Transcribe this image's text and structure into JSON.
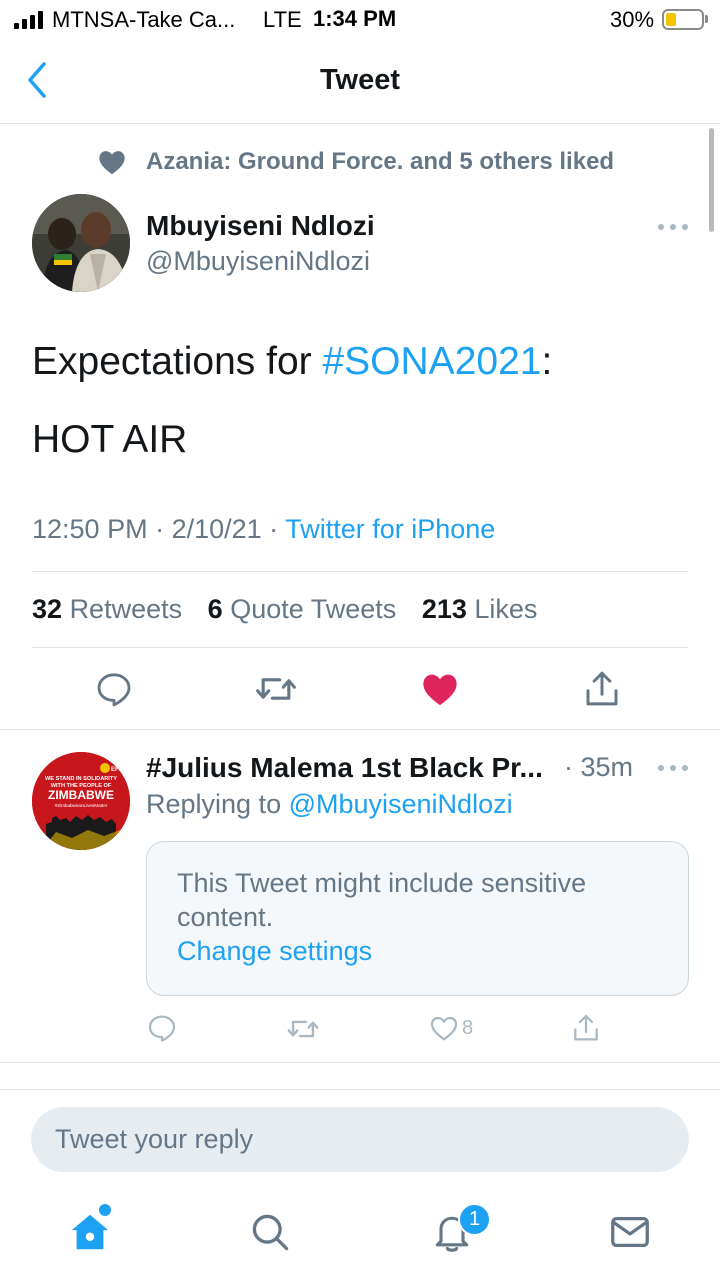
{
  "status_bar": {
    "carrier": "MTNSA-Take Ca...",
    "network": "LTE",
    "time": "1:34 PM",
    "battery_percent": "30%",
    "battery_level": 0.3
  },
  "nav": {
    "title": "Tweet",
    "back_icon": "chevron-left-icon"
  },
  "tweet": {
    "social_context": "Azania: Ground Force. and 5 others liked",
    "author_name": "Mbuyiseni Ndlozi",
    "author_handle": "@MbuyiseniNdlozi",
    "text_prefix": "Expectations for ",
    "hashtag": "#SONA2021",
    "text_suffix": ":",
    "text_line2": "HOT AIR",
    "time": "12:50 PM",
    "date": "2/10/21",
    "meta_sep": " · ",
    "source": "Twitter for iPhone",
    "stats": {
      "retweets_count": "32",
      "retweets_label": "Retweets",
      "quotes_count": "6",
      "quotes_label": "Quote Tweets",
      "likes_count": "213",
      "likes_label": "Likes"
    },
    "liked": true
  },
  "reply": {
    "author_name": "#Julius Malema 1st Black Pr...",
    "time": "· 35m",
    "replying_prefix": "Replying to ",
    "replying_to": "@MbuyiseniNdlozi",
    "sensitive_text": "This Tweet might include sensitive content.",
    "change_settings": "Change settings",
    "like_count": "8",
    "avatar_text": {
      "line1": "WE STAND IN SOLIDARITY",
      "line2": "WITH THE PEOPLE OF",
      "line3": "ZIMBABWE",
      "line4": "#ZimbabweanLivesMatter",
      "logo": "EFF"
    }
  },
  "composer": {
    "placeholder": "Tweet your reply"
  },
  "tab_bar": {
    "notifications_badge": "1"
  },
  "colors": {
    "accent": "#1da1f2",
    "like": "#e0245e",
    "secondary_text": "#657786"
  }
}
